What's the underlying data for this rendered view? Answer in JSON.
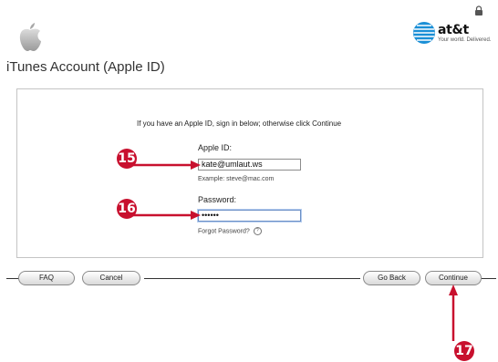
{
  "header": {
    "brand_name": "at&t",
    "brand_tagline": "Your world. Delivered.",
    "page_title": "iTunes Account (Apple ID)"
  },
  "form": {
    "intro": "If you have an Apple ID, sign in below; otherwise click Continue",
    "apple_id_label": "Apple ID:",
    "apple_id_value": "kate@umlaut.ws",
    "apple_id_hint": "Example: steve@mac.com",
    "password_label": "Password:",
    "password_value": "••••••",
    "forgot_password": "Forgot Password?",
    "forgot_icon_glyph": "?"
  },
  "buttons": {
    "faq": "FAQ",
    "cancel": "Cancel",
    "go_back": "Go Back",
    "continue": "Continue"
  },
  "callouts": {
    "step_15": "15",
    "step_16": "16",
    "step_17": "17"
  },
  "colors": {
    "callout_red": "#c8102e",
    "focus_blue": "#6a8fc6",
    "brand_blue": "#1a8fd6"
  },
  "icons": [
    "lock-icon",
    "apple-logo-icon",
    "att-globe-icon",
    "help-icon"
  ]
}
